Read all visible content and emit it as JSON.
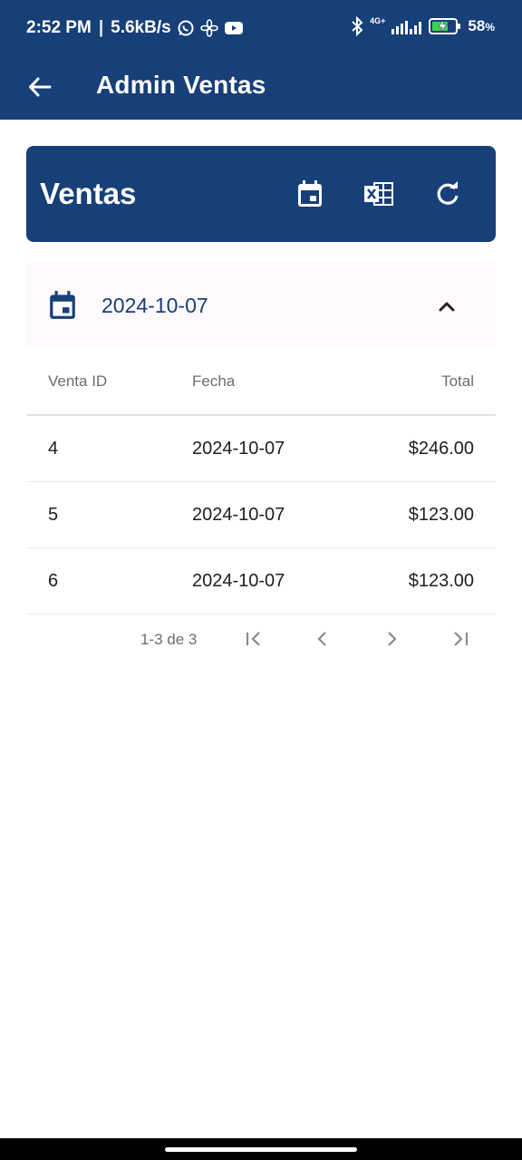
{
  "status_bar": {
    "time": "2:52 PM",
    "speed": "5.6kB/s",
    "network": "4G+",
    "battery": "58",
    "battery_unit": "%",
    "icons": [
      "whatsapp-icon",
      "fan-icon",
      "youtube-icon",
      "bluetooth-icon",
      "signal-icon",
      "battery-charging-icon"
    ]
  },
  "app_bar": {
    "title": "Admin Ventas",
    "back_icon": "arrow-back-icon"
  },
  "header_card": {
    "title": "Ventas",
    "actions": [
      "calendar-icon",
      "excel-export-icon",
      "refresh-icon"
    ]
  },
  "date_filter": {
    "value": "2024-10-07"
  },
  "table": {
    "columns": [
      "Venta ID",
      "Fecha",
      "Total"
    ],
    "rows": [
      {
        "id": "4",
        "date": "2024-10-07",
        "total": "$246.00"
      },
      {
        "id": "5",
        "date": "2024-10-07",
        "total": "$123.00"
      },
      {
        "id": "6",
        "date": "2024-10-07",
        "total": "$123.00"
      }
    ]
  },
  "pagination": {
    "range": "1-3 de 3"
  },
  "colors": {
    "primary": "#173f78",
    "panel": "#fdf9fc"
  }
}
